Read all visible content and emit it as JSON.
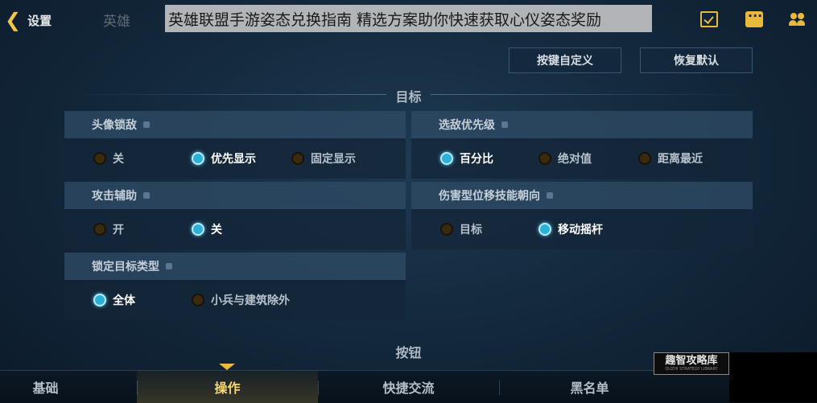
{
  "header": {
    "back_label": "设置",
    "overlay_prefix": "英雄",
    "overlay_title": "英雄联盟手游姿态兑换指南 精选方案助你快速获取心仪姿态奖励"
  },
  "top_buttons": {
    "custom_keys": "按键自定义",
    "restore_default": "恢复默认"
  },
  "section_target": "目标",
  "section_buttons": "按钮",
  "panels": {
    "avatar_lock": {
      "title": "头像锁敌",
      "options": [
        "关",
        "优先显示",
        "固定显示"
      ],
      "selected": "优先显示"
    },
    "enemy_priority": {
      "title": "选敌优先级",
      "options": [
        "百分比",
        "绝对值",
        "距离最近"
      ],
      "selected": "百分比"
    },
    "attack_assist": {
      "title": "攻击辅助",
      "options": [
        "开",
        "关"
      ],
      "selected": "关"
    },
    "skill_direction": {
      "title": "伤害型位移技能朝向",
      "options": [
        "目标",
        "移动摇杆"
      ],
      "selected": "移动摇杆"
    },
    "lock_target_type": {
      "title": "锁定目标类型",
      "options": [
        "全体",
        "小兵与建筑除外"
      ],
      "selected": "全体"
    }
  },
  "tabs": [
    "基础",
    "操作",
    "快捷交流",
    "黑名单"
  ],
  "active_tab": "操作",
  "watermark": {
    "title": "趣智攻略库",
    "subtitle": "QUZHI STRATEGY LIBRARY"
  },
  "colors": {
    "accent_gold": "#e9b93c",
    "radio_on": "#2bb0d8",
    "background": "#142a3e"
  }
}
